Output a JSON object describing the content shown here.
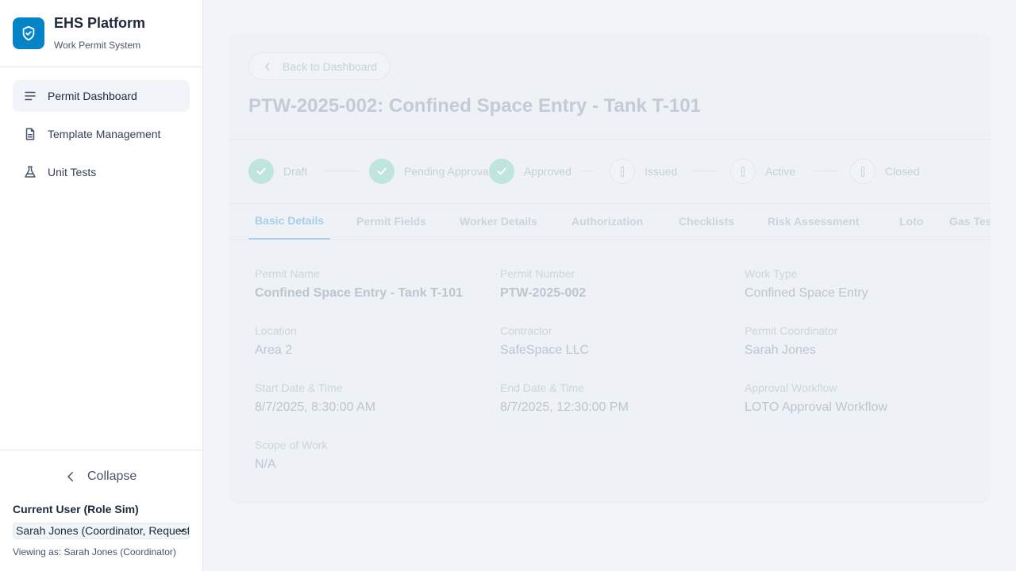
{
  "brand": {
    "title": "EHS Platform",
    "subtitle": "Work Permit System",
    "icon": "shield-check-icon"
  },
  "nav": [
    {
      "label": "Permit Dashboard",
      "icon": "list-icon",
      "active": true
    },
    {
      "label": "Template Management",
      "icon": "document-icon",
      "active": false
    },
    {
      "label": "Unit Tests",
      "icon": "flask-icon",
      "active": false
    }
  ],
  "footer": {
    "collapse_label": "Collapse",
    "role_label": "Current User (Role Sim)",
    "role_selected": "Sarah Jones (Coordinator, Requester)",
    "viewing_as": "Viewing as: Sarah Jones (Coordinator)"
  },
  "permit": {
    "back_label": "Back to Dashboard",
    "title": "PTW-2025-002: Confined Space Entry - Tank T-101"
  },
  "steps": [
    {
      "label": "Draft",
      "state": "done"
    },
    {
      "label": "Pending Approval",
      "state": "done"
    },
    {
      "label": "Approved",
      "state": "done"
    },
    {
      "label": "Issued",
      "state": "todo"
    },
    {
      "label": "Active",
      "state": "todo"
    },
    {
      "label": "Closed",
      "state": "todo"
    }
  ],
  "tabs": [
    {
      "label": "Basic Details",
      "active": true
    },
    {
      "label": "Permit Fields"
    },
    {
      "label": "Worker Details"
    },
    {
      "label": "Authorization"
    },
    {
      "label": "Checklists"
    },
    {
      "label": "Risk Assessment"
    },
    {
      "label": "Loto"
    },
    {
      "label": "Gas Tests"
    }
  ],
  "details": {
    "permit_name": {
      "label": "Permit Name",
      "value": "Confined Space Entry - Tank T-101"
    },
    "permit_number": {
      "label": "Permit Number",
      "value": "PTW-2025-002"
    },
    "work_type": {
      "label": "Work Type",
      "value": "Confined Space Entry"
    },
    "location": {
      "label": "Location",
      "value": "Area 2"
    },
    "contractor": {
      "label": "Contractor",
      "value": "SafeSpace LLC"
    },
    "coordinator": {
      "label": "Permit Coordinator",
      "value": "Sarah Jones"
    },
    "start": {
      "label": "Start Date & Time",
      "value": "8/7/2025, 8:30:00 AM"
    },
    "end": {
      "label": "End Date & Time",
      "value": "8/7/2025, 12:30:00 PM"
    },
    "workflow": {
      "label": "Approval Workflow",
      "value": "LOTO Approval Workflow"
    },
    "scope": {
      "label": "Scope of Work",
      "value": "N/A"
    }
  },
  "colors": {
    "accent": "#0284c7",
    "done": "#bfe5dc"
  }
}
